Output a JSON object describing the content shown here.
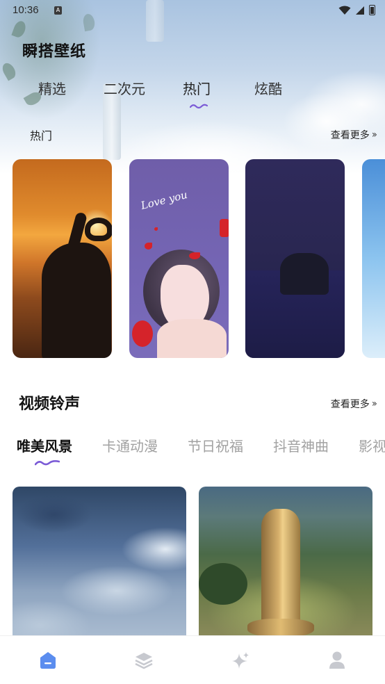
{
  "status_bar": {
    "time": "10:36",
    "notif_badge": "A"
  },
  "app": {
    "title": "瞬搭壁纸"
  },
  "top_tabs": [
    {
      "label": "精选",
      "active": false
    },
    {
      "label": "二次元",
      "active": false
    },
    {
      "label": "热门",
      "active": true
    },
    {
      "label": "炫酷",
      "active": false
    }
  ],
  "hot_section": {
    "title": "热门",
    "more_label": "查看更多",
    "love_card_text": "Love you"
  },
  "video_section": {
    "title": "视频铃声",
    "more_label": "查看更多",
    "categories": [
      {
        "label": "唯美风景",
        "active": true
      },
      {
        "label": "卡通动漫",
        "active": false
      },
      {
        "label": "节日祝福",
        "active": false
      },
      {
        "label": "抖音神曲",
        "active": false
      },
      {
        "label": "影视",
        "active": false
      }
    ]
  },
  "bottom_nav": [
    {
      "icon": "home-icon",
      "active": true
    },
    {
      "icon": "layers-icon",
      "active": false
    },
    {
      "icon": "sparkle-icon",
      "active": false
    },
    {
      "icon": "profile-icon",
      "active": false
    }
  ],
  "colors": {
    "accent": "#5b8def",
    "squiggle": "#7b5bd6",
    "nav_inactive": "#c7c9cf",
    "tab_inactive": "#a2a2a2"
  }
}
